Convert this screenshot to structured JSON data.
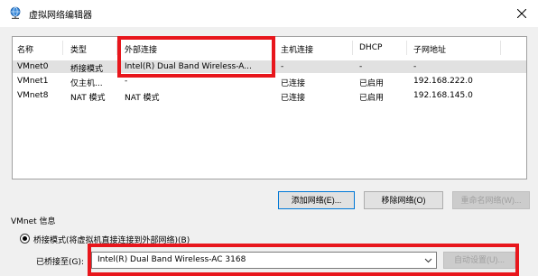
{
  "window": {
    "title": "虚拟网络编辑器",
    "close_icon": "close-icon",
    "app_icon": "globe-network-icon"
  },
  "table": {
    "columns": [
      "名称",
      "类型",
      "外部连接",
      "主机连接",
      "DHCP",
      "子网地址"
    ],
    "rows": [
      {
        "name": "VMnet0",
        "type": "桥接模式",
        "external": "Intel(R) Dual Band Wireless-A...",
        "host": "-",
        "dhcp": "-",
        "subnet": "-",
        "selected": true
      },
      {
        "name": "VMnet1",
        "type": "仅主机...",
        "external": "-",
        "host": "已连接",
        "dhcp": "已启用",
        "subnet": "192.168.222.0",
        "selected": false
      },
      {
        "name": "VMnet8",
        "type": "NAT 模式",
        "external": "NAT 模式",
        "host": "已连接",
        "dhcp": "已启用",
        "subnet": "192.168.145.0",
        "selected": false
      }
    ]
  },
  "buttons": {
    "add_network": "添加网络(E)...",
    "remove_network": "移除网络(O)",
    "rename_network": "重命名网络(W)..."
  },
  "info": {
    "group_label": "VMnet 信息",
    "bridged_radio": "桥接模式(将虚拟机直接连接到外部网络)(B)",
    "bridged_to_label": "已桥接至(G):",
    "bridged_to_value": "Intel(R) Dual Band Wireless-AC 3168",
    "auto_settings": "自动设置(U)..."
  },
  "colors": {
    "highlight": "#e8161c",
    "selected_row": "#e1e1e1"
  }
}
